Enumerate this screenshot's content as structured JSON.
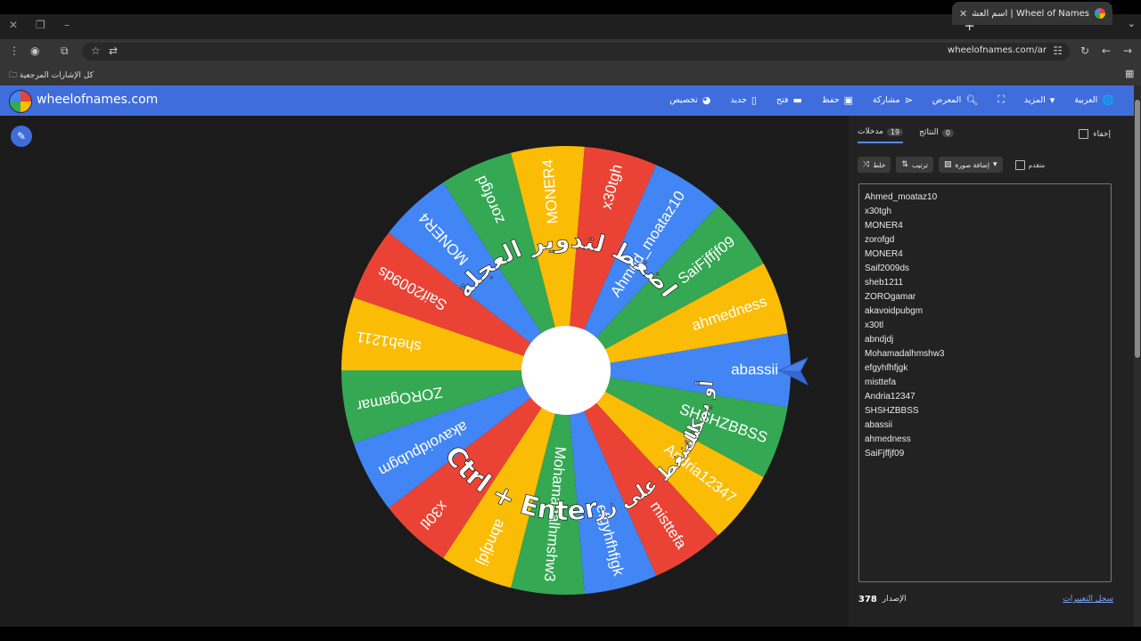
{
  "browser": {
    "tab_title": "Wheel of Names | اسم العشوائي",
    "url": "wheelofnames.com/ar",
    "bookmarks_label": "كل الإشارات المرجعية"
  },
  "app": {
    "brand": "wheelofnames.com",
    "accent_color": "#3f6ddc",
    "nav": [
      {
        "label": "العربية",
        "icon": "globe-icon"
      },
      {
        "label": "المزيد",
        "icon": "chevron-down-icon"
      },
      {
        "label": "",
        "icon": "fullscreen-icon"
      },
      {
        "label": "المعرض",
        "icon": "search-icon"
      },
      {
        "label": "مشاركة",
        "icon": "share-icon"
      },
      {
        "label": "حفظ",
        "icon": "save-icon"
      },
      {
        "label": "فتح",
        "icon": "folder-icon"
      },
      {
        "label": "جديد",
        "icon": "file-icon"
      },
      {
        "label": "تخصيص",
        "icon": "palette-icon"
      }
    ]
  },
  "wheel": {
    "colors": [
      "#4285f4",
      "#34a853",
      "#fbbc05",
      "#ea4335"
    ],
    "slices": [
      "abassii",
      "SHSHZBBSS",
      "Andria12347",
      "misttefa",
      "efgyhfhfjgk",
      "Mohamadalhmshw3",
      "abndjdj",
      "x30tl",
      "akavoidpubgm",
      "ZOROgamar",
      "sheb1211",
      "Saif2009ds",
      "MONER4",
      "zorofgd",
      "MONER4",
      "x30tgh",
      "Ahmed_moataz10",
      "SaiFjffjf09",
      "ahmedness"
    ],
    "overlay_top": "اضغط لتدوير العجلة",
    "overlay_bottom_1": "أو يمكنك",
    "overlay_bottom_2": "الضغط على زر",
    "overlay_keys": "Ctrl + Enter"
  },
  "panel": {
    "tab_entries": "مدخلات",
    "entries_count": "19",
    "tab_results": "النتائج",
    "results_count": "0",
    "hide_label": "إخفاء",
    "shuffle_label": "خلط",
    "sort_label": "ترتيب",
    "add_image_label": "إضافة صورة",
    "advanced_label": "متقدم",
    "entries": [
      "Ahmed_moataz10",
      "x30tgh",
      "MONER4",
      "zorofgd",
      "MONER4",
      "Saif2009ds",
      "sheb1211",
      "ZOROgamar",
      "akavoidpubgm",
      "x30tl",
      "abndjdj",
      "Mohamadalhmshw3",
      "efgyhfhfjgk",
      "misttefa",
      "Andria12347",
      "SHSHZBBSS",
      "abassii",
      "ahmedness",
      "SaiFjffjf09"
    ],
    "version_label": "الإصدار",
    "version_number": "378",
    "changelog_label": "سجل التغييرات"
  }
}
